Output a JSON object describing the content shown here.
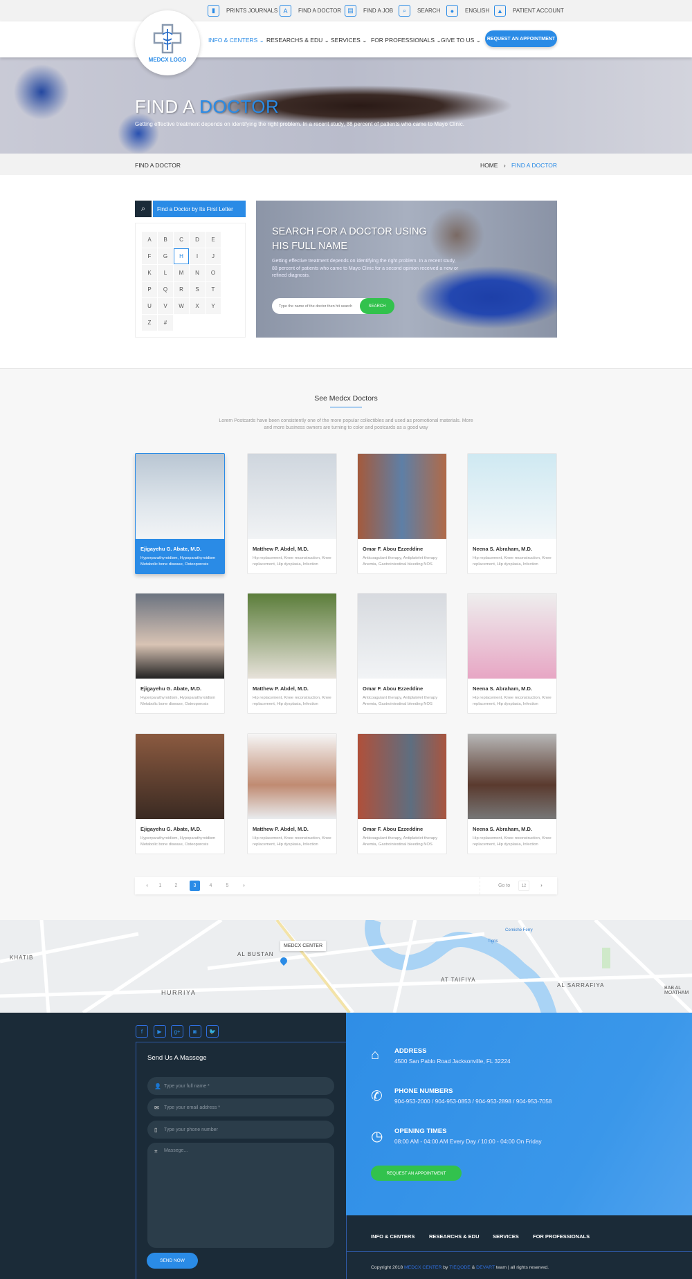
{
  "topbar": [
    {
      "label": "PRINTS JOURNALS",
      "icon": "book-icon"
    },
    {
      "label": "FIND A DOCTOR",
      "icon": "doctor-icon"
    },
    {
      "label": "FIND A JOB",
      "icon": "job-icon"
    },
    {
      "label": "SEARCH",
      "icon": "search-icon"
    },
    {
      "label": "ENGLISH",
      "icon": "globe-icon"
    },
    {
      "label": "PATIENT ACCOUNT",
      "icon": "user-icon"
    }
  ],
  "logo": {
    "text": "MEDCX LOGO"
  },
  "nav": {
    "items": [
      "INFO & CENTERS",
      "RESEARCHS & EDU",
      "SERVICES",
      "FOR PROFESSIONALS",
      "GIVE TO US"
    ],
    "cta": "REQUEST AN APPOINTMENT"
  },
  "hero": {
    "title_a": "FIND A",
    "title_b": "DOCTOR",
    "subtitle": "Getting effective treatment depends on identifying the right problem. In a recent study, 88 percent of patients who came to Mayo Clinic."
  },
  "breadcrumb": {
    "page": "FIND A DOCTOR",
    "home": "HOME",
    "current": "FIND A DOCTOR"
  },
  "letters": {
    "header": "Find a Doctor by Its First Letter",
    "items": [
      "A",
      "B",
      "C",
      "D",
      "E",
      "F",
      "G",
      "H",
      "I",
      "J",
      "K",
      "L",
      "M",
      "N",
      "O",
      "P",
      "Q",
      "R",
      "S",
      "T",
      "U",
      "V",
      "W",
      "X",
      "Y",
      "Z",
      "#"
    ],
    "selected": "H"
  },
  "search": {
    "title": "SEARCH FOR A DOCTOR USING HIS FULL NAME",
    "desc": "Getting effective treatment depends on identifying the right problem. In a recent study, 88 percent of patients who came to Mayo Clinic for a second opinion received a new or refined diagnosis.",
    "placeholder": "Type the name of the doctor then hit search",
    "button": "SEARCH"
  },
  "doctors_section": {
    "title": "See Medcx Doctors",
    "desc": "Lorem Postcards have been consistently one of the more popular collectibles and used as promotional materials. More and more business owners are turning to color and postcards as a good way"
  },
  "doctors": [
    {
      "name": "Ejigayehu G. Abate, M.D.",
      "spec": "Hyperparathyroidism, Hypoparathyroidism Metabolic bone disease, Osteoporosis"
    },
    {
      "name": "Matthew P. Abdel, M.D.",
      "spec": "Hip replacement, Knee reconstruction, Knee replacement, Hip dysplasia, Infection"
    },
    {
      "name": "Omar F. Abou Ezzeddine",
      "spec": "Anticoagulant therapy, Antiplatelet therapy Anemia, Gastrointestinal bleeding NOS"
    },
    {
      "name": "Neena S. Abraham, M.D.",
      "spec": "Hip replacement, Knee reconstruction, Knee replacement, Hip dysplasia, Infection"
    },
    {
      "name": "Ejigayehu G. Abate, M.D.",
      "spec": "Hyperparathyroidism, Hypoparathyroidism Metabolic bone disease, Osteoporosis"
    },
    {
      "name": "Matthew P. Abdel, M.D.",
      "spec": "Hip replacement, Knee reconstruction, Knee replacement, Hip dysplasia, Infection"
    },
    {
      "name": "Omar F. Abou Ezzeddine",
      "spec": "Anticoagulant therapy, Antiplatelet therapy Anemia, Gastrointestinal bleeding NOS"
    },
    {
      "name": "Neena S. Abraham, M.D.",
      "spec": "Hip replacement, Knee reconstruction, Knee replacement, Hip dysplasia, Infection"
    },
    {
      "name": "Ejigayehu G. Abate, M.D.",
      "spec": "Hyperparathyroidism, Hypoparathyroidism Metabolic bone disease, Osteoporosis"
    },
    {
      "name": "Matthew P. Abdel, M.D.",
      "spec": "Hip replacement, Knee reconstruction, Knee replacement, Hip dysplasia, Infection"
    },
    {
      "name": "Omar F. Abou Ezzeddine",
      "spec": "Anticoagulant therapy, Antiplatelet therapy Anemia, Gastrointestinal bleeding NOS"
    },
    {
      "name": "Neena S. Abraham, M.D.",
      "spec": "Hip replacement, Knee reconstruction, Knee replacement, Hip dysplasia, Infection"
    }
  ],
  "pagination": {
    "pages": [
      "1",
      "2",
      "3",
      "4",
      "5"
    ],
    "current": "3",
    "goto_label": "Go to",
    "goto_value": "12"
  },
  "map": {
    "marker": "MEDCX CENTER",
    "labels": [
      "KHATIB",
      "AL BUSTAN",
      "HURRIYA",
      "AT TAIFIYA",
      "AL SARRAFIYA",
      "BAB AL MOATHAM",
      "Corniche Ferry",
      "Tigris"
    ]
  },
  "social": [
    "facebook-icon",
    "youtube-icon",
    "google-plus-icon",
    "instagram-icon",
    "twitter-icon"
  ],
  "form": {
    "title": "Send Us A Massege",
    "name": "Type your full name *",
    "email": "Type your email address *",
    "phone": "Type your phone number",
    "message": "Massege...",
    "submit": "SEND NOW"
  },
  "contact": {
    "address_title": "ADDRESS",
    "address": "4500 San Pablo Road Jacksonville, FL 32224",
    "phone_title": "PHONE NUMBERS",
    "phones": "904-953-2000 / 904-953-0853 / 904-953-2898 / 904-953-7058",
    "hours_title": "OPENING TIMES",
    "hours": "08:00 AM - 04:00 AM Every Day / 10:00 - 04:00 On Friday",
    "cta": "REQUEST AN APPOINTMENT"
  },
  "footer_nav": [
    "INFO & CENTERS",
    "RESEARCHS & EDU",
    "SERVICES",
    "FOR PROFESSIONALS"
  ],
  "copyright": {
    "a": "Copyright 2018",
    "brand": "MEDCX CENTER",
    "b": "by",
    "c": "TIEQODE",
    "d": "&",
    "e": "DEVART",
    "f": "team | all rights reserved."
  },
  "colors": {
    "accent": "#2a8be6",
    "green": "#32c24d",
    "dark": "#1b2b38"
  }
}
